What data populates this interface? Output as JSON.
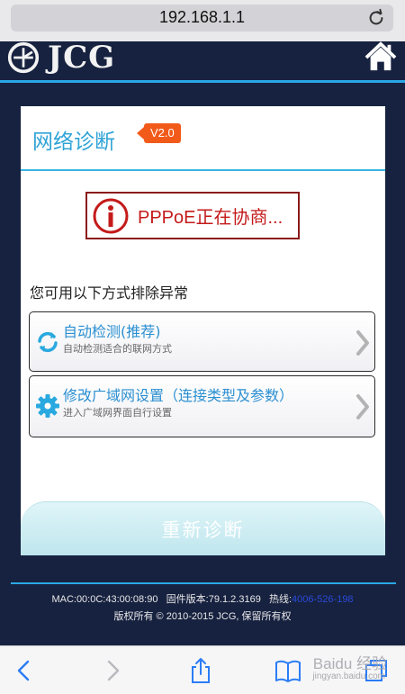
{
  "browser": {
    "url": "192.168.1.1"
  },
  "header": {
    "logo_text": "JCG"
  },
  "panel": {
    "title": "网络诊断",
    "version": "V2.0",
    "status_text": "PPPoE正在协商...",
    "hint": "您可用以下方式排除异常",
    "options": [
      {
        "title": "自动检测(推荐)",
        "subtitle": "自动检测适合的联网方式"
      },
      {
        "title": "修改广域网设置（连接类型及参数）",
        "subtitle": "进入广域网界面自行设置"
      }
    ],
    "rediagnose_label": "重新诊断"
  },
  "footer": {
    "mac_label": "MAC:00:0C:43:00:08:90",
    "firmware_label": "固件版本:79.1.2.3169",
    "hotline_label": "热线:",
    "hotline_number": "4006-526-198",
    "copyright": "版权所有 © 2010-2015 JCG, 保留所有权"
  },
  "watermark": {
    "text": "Baidu 经验",
    "sub": "jingyan.baidu.com"
  },
  "colors": {
    "accent": "#2aa7e6",
    "header_bg": "#172240",
    "error": "#c41a1a",
    "version_badge": "#f25a1a"
  }
}
